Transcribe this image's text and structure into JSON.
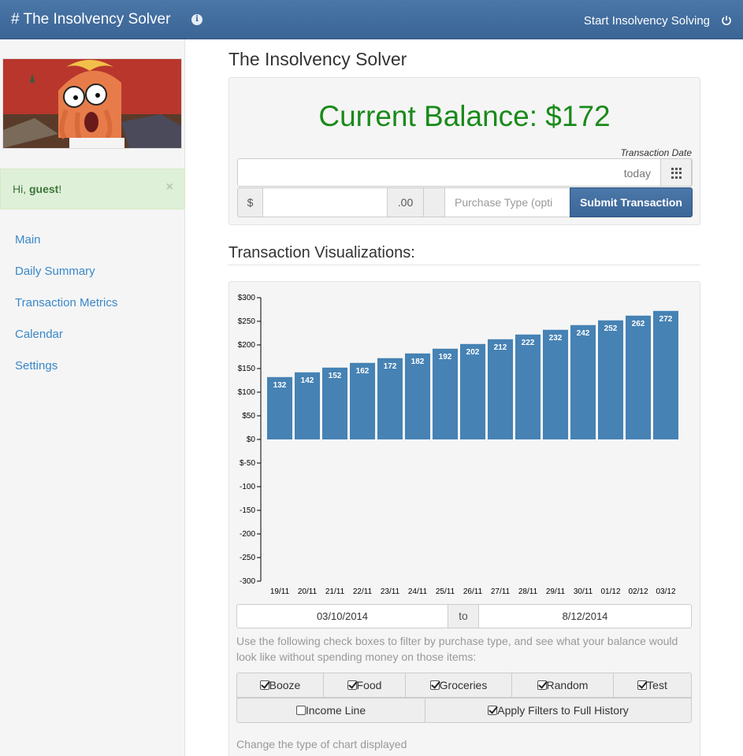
{
  "navbar": {
    "brand": "# The Insolvency Solver",
    "info_icon": "info-icon",
    "start_label": "Start Insolvency Solving",
    "power_icon": "power-icon"
  },
  "sidebar": {
    "alert": {
      "greeting": "Hi, ",
      "user": "guest",
      "suffix": "!",
      "close": "×"
    },
    "items": [
      {
        "label": "Main"
      },
      {
        "label": "Daily Summary"
      },
      {
        "label": "Transaction Metrics"
      },
      {
        "label": "Calendar"
      },
      {
        "label": "Settings"
      }
    ]
  },
  "main": {
    "title": "The Insolvency Solver",
    "balance": "Current Balance: $172",
    "date_label": "Transaction Date",
    "date_placeholder": "today",
    "currency": "$",
    "cents": ".00",
    "purchase_placeholder": "Purchase Type (opti",
    "submit_label": "Submit Transaction",
    "viz_title": "Transaction Visualizations:",
    "range_from": "03/10/2014",
    "range_to_label": "to",
    "range_to": "8/12/2014",
    "filter_help": "Use the following check boxes to filter by purchase type, and see what your balance would look like without spending money on those items:",
    "filters": [
      {
        "label": "Booze",
        "checked": true
      },
      {
        "label": "Food",
        "checked": true
      },
      {
        "label": "Groceries",
        "checked": true
      },
      {
        "label": "Random",
        "checked": true
      },
      {
        "label": "Test",
        "checked": true
      }
    ],
    "options": [
      {
        "label": "Income Line",
        "checked": false
      },
      {
        "label": "Apply Filters to Full History",
        "checked": true
      }
    ],
    "chart_type_label": "Change the type of chart displayed"
  },
  "colors": {
    "navbar": "#3a6595",
    "balance": "#1a8a1a",
    "bar": "#4682b4",
    "link": "#3a87c9",
    "alert_bg": "#dff0d8"
  },
  "chart_data": {
    "type": "bar",
    "categories": [
      "19/11",
      "20/11",
      "21/11",
      "22/11",
      "23/11",
      "24/11",
      "25/11",
      "26/11",
      "27/11",
      "28/11",
      "29/11",
      "30/11",
      "01/12",
      "02/12",
      "03/12"
    ],
    "values": [
      132,
      142,
      152,
      162,
      172,
      182,
      192,
      202,
      212,
      222,
      232,
      242,
      252,
      262,
      272
    ],
    "y_ticks": [
      "$300",
      "$250",
      "$200",
      "$150",
      "$100",
      "$50",
      "$0",
      "$-50",
      "-100",
      "-150",
      "-200",
      "-250",
      "-300"
    ],
    "ylim": [
      -300,
      300
    ],
    "title": "",
    "xlabel": "",
    "ylabel": ""
  }
}
